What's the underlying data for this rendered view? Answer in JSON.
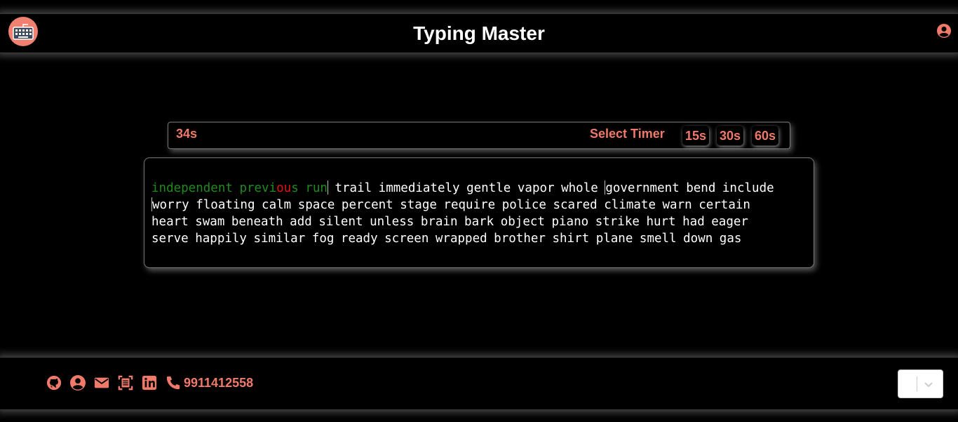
{
  "header": {
    "title": "Typing Master",
    "logo_icon": "keyboard-icon",
    "user_icon": "user-circle-icon"
  },
  "timer": {
    "remaining": "34s",
    "select_label": "Select Timer",
    "options": [
      "15s",
      "30s",
      "60s"
    ]
  },
  "typing": {
    "typed_words": [
      {
        "text": "independent",
        "state": "correct"
      },
      {
        "text": "previ",
        "state": "correct"
      },
      {
        "text": "ou",
        "state": "incorrect"
      },
      {
        "text": "s",
        "state": "correct"
      },
      {
        "text": "run",
        "state": "correct"
      }
    ],
    "line1_rest": "trail immediately gentle vapor whole",
    "line1_end": "government bend include",
    "line2": "worry floating calm space percent stage require police scared climate warn certain",
    "line3": "heart swam beneath add silent unless brain bark object piano strike hurt had eager",
    "line4": "serve happily similar fog ready screen wrapped brother shirt plane smell down gas"
  },
  "footer": {
    "icons": [
      "github-icon",
      "user-circle-icon",
      "mail-icon",
      "resume-icon",
      "linkedin-icon",
      "phone-icon"
    ],
    "phone": "9911412558",
    "select_value": ""
  },
  "colors": {
    "accent": "#f07a6a",
    "correct": "#1f8a1f",
    "incorrect": "#e01010",
    "background": "#000000"
  }
}
